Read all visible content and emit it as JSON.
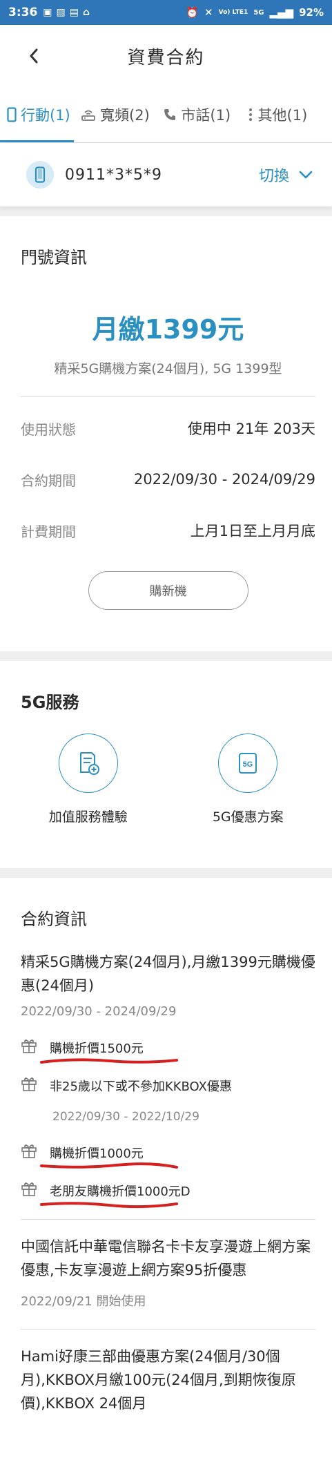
{
  "status": {
    "time": "3:36",
    "battery": "92%",
    "sig1": "Vo) LTE1",
    "sig2": "5G"
  },
  "header": {
    "title": "資費合約"
  },
  "tabs": [
    {
      "label": "行動(1)"
    },
    {
      "label": "寬頻(2)"
    },
    {
      "label": "市話(1)"
    },
    {
      "label": "其他(1)"
    }
  ],
  "number_bar": {
    "number": "0911*3*5*9",
    "switch_label": "切換"
  },
  "info": {
    "title": "門號資訊",
    "monthly": "月繳1399元",
    "plan": "精采5G購機方案(24個月), 5G 1399型",
    "rows": [
      {
        "label": "使用狀態",
        "value": "使用中 21年 203天"
      },
      {
        "label": "合約期間",
        "value": "2022/09/30 - 2024/09/29"
      },
      {
        "label": "計費期間",
        "value": "上月1日至上月月底"
      }
    ],
    "button": "購新機"
  },
  "services": {
    "title": "5G服務",
    "items": [
      {
        "label": "加值服務體驗",
        "icon": "add-document-icon"
      },
      {
        "label": "5G優惠方案",
        "icon": "5g-icon"
      }
    ]
  },
  "contract": {
    "title": "合約資訊",
    "items": [
      {
        "title": "精采5G購機方案(24個月),月繳1399元購機優惠(24個月)",
        "date": "2022/09/30 - 2024/09/29",
        "promos": [
          {
            "text": "購機折價1500元",
            "date": ""
          },
          {
            "text": "非25歲以下或不參加KKBOX優惠",
            "date": "2022/09/30 - 2022/10/29"
          },
          {
            "text": "購機折價1000元",
            "date": ""
          },
          {
            "text": "老朋友購機折價1000元D",
            "date": ""
          }
        ]
      },
      {
        "title": "中國信託中華電信聯名卡卡友享漫遊上網方案優惠,卡友享漫遊上網方案95折優惠",
        "date": "2022/09/21 開始使用"
      },
      {
        "title": "Hami好康三部曲優惠方案(24個月/30個月),KKBOX月繳100元(24個月,到期恢復原價),KKBOX 24個月",
        "date": ""
      }
    ]
  },
  "colors": {
    "accent": "#2a8fc1",
    "statusbar": "#2f76b8",
    "annotation": "#d62020"
  }
}
